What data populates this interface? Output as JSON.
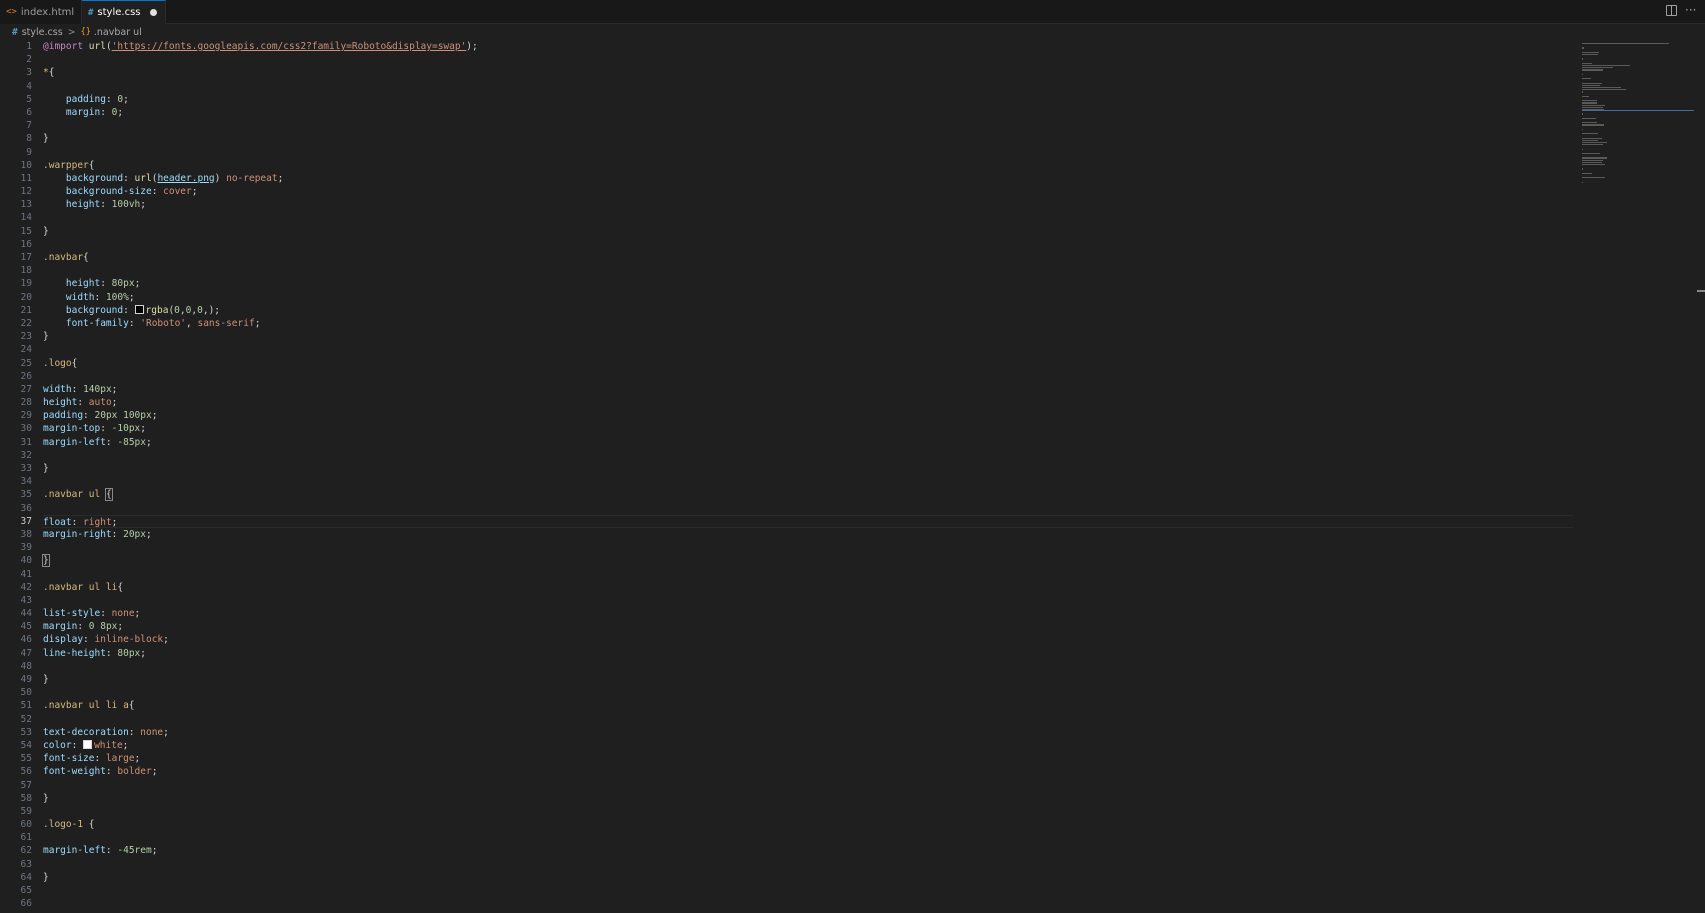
{
  "tabs": [
    {
      "icon": "<>",
      "label": "index.html",
      "active": false
    },
    {
      "icon": "#",
      "label": "style.css",
      "active": true,
      "dirty": true
    }
  ],
  "breadcrumb": {
    "file_icon": "#",
    "file": "style.css",
    "separator": ">",
    "symbol_icon": "{}",
    "symbol": ".navbar ul"
  },
  "editor": {
    "active_line": 37,
    "line_count": 66
  },
  "colors": {
    "selector": "#d7ba7d",
    "property": "#9cdcfe",
    "number": "#b5cea8",
    "value": "#ce9178",
    "background": "#1f1f1f"
  },
  "code_lines": [
    [
      [
        "at",
        "@import"
      ],
      [
        "punc",
        " "
      ],
      [
        "fn",
        "url"
      ],
      [
        "punc",
        "("
      ],
      [
        "strlink",
        "'https://fonts.googleapis.com/css2?family=Roboto&display=swap'"
      ],
      [
        "punc",
        ");"
      ]
    ],
    [],
    [
      [
        "sel",
        "*"
      ],
      [
        "punc",
        "{"
      ]
    ],
    [],
    [
      [
        "punc",
        "    "
      ],
      [
        "prop",
        "padding"
      ],
      [
        "punc",
        ": "
      ],
      [
        "num",
        "0"
      ],
      [
        "punc",
        ";"
      ]
    ],
    [
      [
        "punc",
        "    "
      ],
      [
        "prop",
        "margin"
      ],
      [
        "punc",
        ": "
      ],
      [
        "num",
        "0"
      ],
      [
        "punc",
        ";"
      ]
    ],
    [],
    [
      [
        "punc",
        "}"
      ]
    ],
    [],
    [
      [
        "sel",
        ".warpper"
      ],
      [
        "punc",
        "{"
      ]
    ],
    [
      [
        "punc",
        "    "
      ],
      [
        "prop",
        "background"
      ],
      [
        "punc",
        ": "
      ],
      [
        "fn",
        "url"
      ],
      [
        "punc",
        "("
      ],
      [
        "link",
        "header.png"
      ],
      [
        "punc",
        ") "
      ],
      [
        "val",
        "no-repeat"
      ],
      [
        "punc",
        ";"
      ]
    ],
    [
      [
        "punc",
        "    "
      ],
      [
        "prop",
        "background-size"
      ],
      [
        "punc",
        ": "
      ],
      [
        "val",
        "cover"
      ],
      [
        "punc",
        ";"
      ]
    ],
    [
      [
        "punc",
        "    "
      ],
      [
        "prop",
        "height"
      ],
      [
        "punc",
        ": "
      ],
      [
        "num",
        "100vh"
      ],
      [
        "punc",
        ";"
      ]
    ],
    [],
    [
      [
        "punc",
        "}"
      ]
    ],
    [],
    [
      [
        "sel",
        ".navbar"
      ],
      [
        "punc",
        "{"
      ]
    ],
    [],
    [
      [
        "punc",
        "    "
      ],
      [
        "prop",
        "height"
      ],
      [
        "punc",
        ": "
      ],
      [
        "num",
        "80px"
      ],
      [
        "punc",
        ";"
      ]
    ],
    [
      [
        "punc",
        "    "
      ],
      [
        "prop",
        "width"
      ],
      [
        "punc",
        ": "
      ],
      [
        "num",
        "100%"
      ],
      [
        "punc",
        ";"
      ]
    ],
    [
      [
        "punc",
        "    "
      ],
      [
        "prop",
        "background"
      ],
      [
        "punc",
        ": "
      ],
      [
        "swatch",
        "black"
      ],
      [
        "fn",
        "rgba"
      ],
      [
        "punc",
        "("
      ],
      [
        "num",
        "0"
      ],
      [
        "punc",
        ","
      ],
      [
        "num",
        "0"
      ],
      [
        "punc",
        ","
      ],
      [
        "num",
        "0"
      ],
      [
        "punc",
        ",);"
      ]
    ],
    [
      [
        "punc",
        "    "
      ],
      [
        "prop",
        "font-family"
      ],
      [
        "punc",
        ": "
      ],
      [
        "str",
        "'Roboto'"
      ],
      [
        "punc",
        ", "
      ],
      [
        "val",
        "sans-serif"
      ],
      [
        "punc",
        ";"
      ]
    ],
    [
      [
        "punc",
        "}"
      ]
    ],
    [],
    [
      [
        "sel",
        ".logo"
      ],
      [
        "punc",
        "{"
      ]
    ],
    [],
    [
      [
        "prop",
        "width"
      ],
      [
        "punc",
        ": "
      ],
      [
        "num",
        "140px"
      ],
      [
        "punc",
        ";"
      ]
    ],
    [
      [
        "prop",
        "height"
      ],
      [
        "punc",
        ": "
      ],
      [
        "val",
        "auto"
      ],
      [
        "punc",
        ";"
      ]
    ],
    [
      [
        "prop",
        "padding"
      ],
      [
        "punc",
        ": "
      ],
      [
        "num",
        "20px 100px"
      ],
      [
        "punc",
        ";"
      ]
    ],
    [
      [
        "prop",
        "margin-top"
      ],
      [
        "punc",
        ": "
      ],
      [
        "num",
        "-10px"
      ],
      [
        "punc",
        ";"
      ]
    ],
    [
      [
        "prop",
        "margin-left"
      ],
      [
        "punc",
        ": "
      ],
      [
        "num",
        "-85px"
      ],
      [
        "punc",
        ";"
      ]
    ],
    [],
    [
      [
        "punc",
        "}"
      ]
    ],
    [],
    [
      [
        "sel",
        ".navbar ul"
      ],
      [
        "punc",
        " "
      ],
      [
        "bracket",
        "{"
      ]
    ],
    [],
    [
      [
        "prop",
        "float"
      ],
      [
        "punc",
        ": "
      ],
      [
        "val",
        "right"
      ],
      [
        "punc",
        ";"
      ]
    ],
    [
      [
        "prop",
        "margin-right"
      ],
      [
        "punc",
        ": "
      ],
      [
        "num",
        "20px"
      ],
      [
        "punc",
        ";"
      ]
    ],
    [],
    [
      [
        "bracket",
        "}"
      ]
    ],
    [],
    [
      [
        "sel",
        ".navbar ul li"
      ],
      [
        "punc",
        "{"
      ]
    ],
    [],
    [
      [
        "prop",
        "list-style"
      ],
      [
        "punc",
        ": "
      ],
      [
        "val",
        "none"
      ],
      [
        "punc",
        ";"
      ]
    ],
    [
      [
        "prop",
        "margin"
      ],
      [
        "punc",
        ": "
      ],
      [
        "num",
        "0 8px"
      ],
      [
        "punc",
        ";"
      ]
    ],
    [
      [
        "prop",
        "display"
      ],
      [
        "punc",
        ": "
      ],
      [
        "val",
        "inline-block"
      ],
      [
        "punc",
        ";"
      ]
    ],
    [
      [
        "prop",
        "line-height"
      ],
      [
        "punc",
        ": "
      ],
      [
        "num",
        "80px"
      ],
      [
        "punc",
        ";"
      ]
    ],
    [],
    [
      [
        "punc",
        "}"
      ]
    ],
    [],
    [
      [
        "sel",
        ".navbar ul li a"
      ],
      [
        "punc",
        "{"
      ]
    ],
    [],
    [
      [
        "prop",
        "text-decoration"
      ],
      [
        "punc",
        ": "
      ],
      [
        "val",
        "none"
      ],
      [
        "punc",
        ";"
      ]
    ],
    [
      [
        "prop",
        "color"
      ],
      [
        "punc",
        ": "
      ],
      [
        "swatch",
        "white"
      ],
      [
        "val",
        "white"
      ],
      [
        "punc",
        ";"
      ]
    ],
    [
      [
        "prop",
        "font-size"
      ],
      [
        "punc",
        ": "
      ],
      [
        "val",
        "large"
      ],
      [
        "punc",
        ";"
      ]
    ],
    [
      [
        "prop",
        "font-weight"
      ],
      [
        "punc",
        ": "
      ],
      [
        "val",
        "bolder"
      ],
      [
        "punc",
        ";"
      ]
    ],
    [],
    [
      [
        "punc",
        "}"
      ]
    ],
    [],
    [
      [
        "sel",
        ".logo-1"
      ],
      [
        "punc",
        " {"
      ]
    ],
    [],
    [
      [
        "prop",
        "margin-left"
      ],
      [
        "punc",
        ": "
      ],
      [
        "num",
        "-45rem"
      ],
      [
        "punc",
        ";"
      ]
    ],
    [],
    [
      [
        "punc",
        "}"
      ]
    ],
    [],
    []
  ]
}
